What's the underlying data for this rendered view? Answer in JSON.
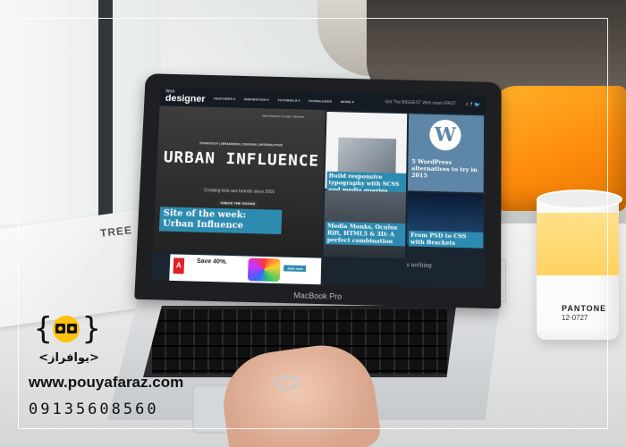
{
  "screen": {
    "logo_small": "Web",
    "logo": "designer",
    "menu": [
      "FEATURES ▾",
      "INSPIRATION ▾",
      "TUTORIALS ▾",
      "DOWNLOADS",
      "MORE ▾"
    ],
    "tagline": "Get The BIGGEST Web news FIRST",
    "social": "⚡ f 🐦",
    "tabs": "New  Board  Create  Careers",
    "hero": {
      "subtitle": "STRATEGY | BRANDING | DESIGN | INTERACTIVE",
      "title": "URBAN INFLUENCE",
      "tagline": "Creating kick-ass brands since 2001",
      "button": "CHECK THE GOODS",
      "caption": "Site of the week: Urban Influence"
    },
    "cards": [
      {
        "caption": "Build responsive typography with SCSS and media queries"
      },
      {
        "caption": "5 WordPress alternatives to try in 2015"
      },
      {
        "caption": "Media Monks, Oculus Rift, HTML5 & 3D: A perfect combination"
      },
      {
        "caption": "From PSD to CSS with Brackets"
      }
    ],
    "ad": {
      "logo": "A",
      "title": "Save 40%.",
      "button": "Join now"
    },
    "bottom_text": "s nothing",
    "model": "MacBook Pro"
  },
  "desk": {
    "paper_text": "TREE",
    "mug_brand": "PANTONE",
    "mug_code": "12-0727"
  },
  "brand": {
    "name_fa": "<یوافراز>",
    "url": "www.pouyafaraz.com",
    "phone": "09135608560",
    "colors": {
      "accent": "#ffc20e",
      "caption_blue": "#2e8bb0"
    }
  }
}
